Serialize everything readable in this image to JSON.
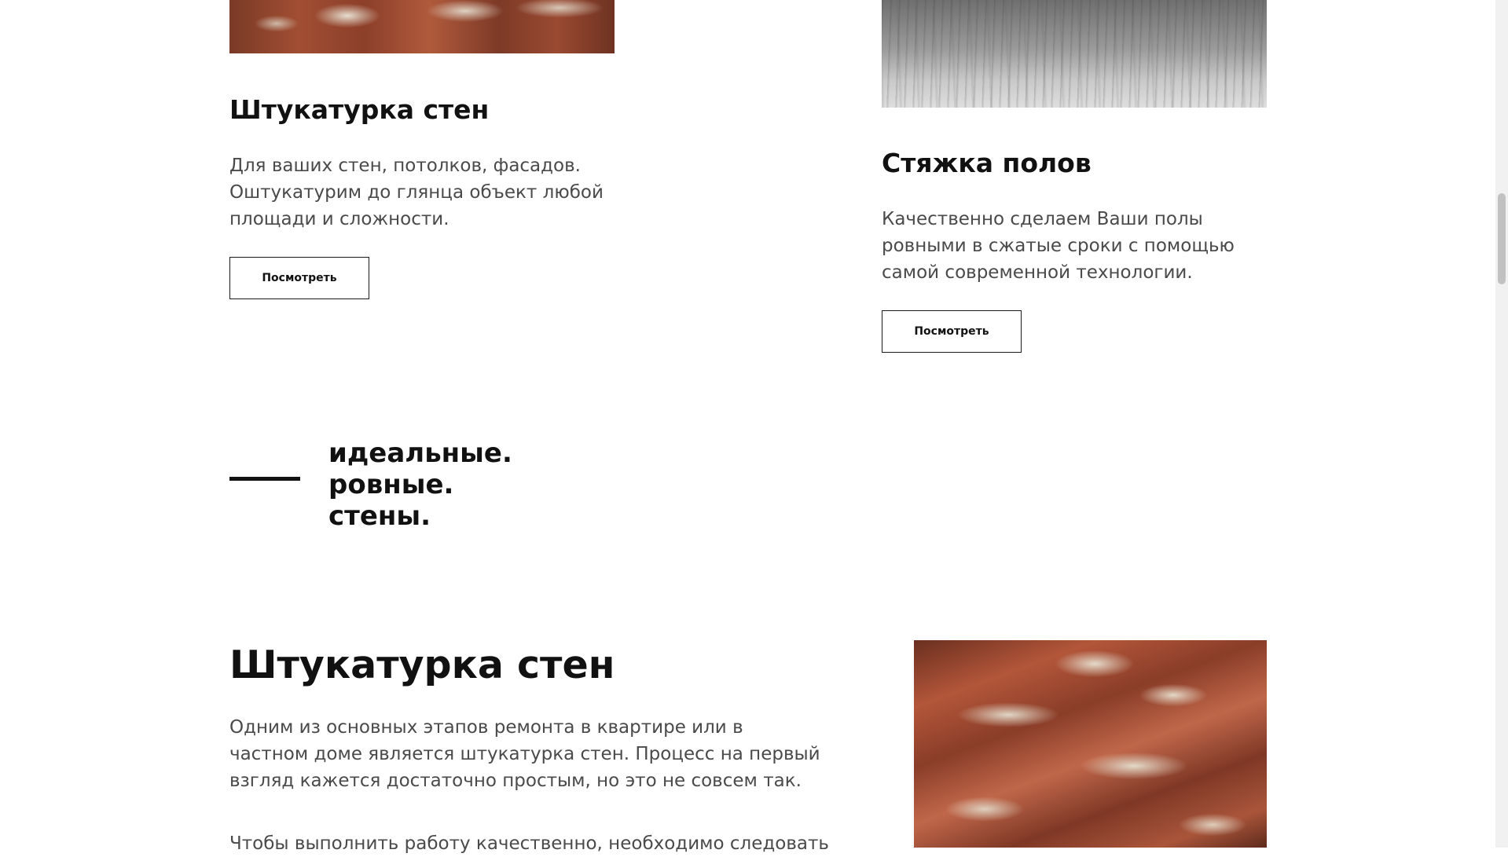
{
  "cards": [
    {
      "title": "Штукатурка стен",
      "description": "Для ваших стен, потолков, фасадов. Оштукатурим до глянца объект любой площади и сложности.",
      "button_label": "Посмотреть",
      "photo": "brick-plaster-photo"
    },
    {
      "title": "Стяжка полов",
      "description": "Качественно сделаем Ваши полы ровными в сжатые сроки с помощью самой современной технологии.",
      "button_label": "Посмотреть",
      "photo": "wood-floor-photo"
    }
  ],
  "slogan": {
    "line1": "идеальные.",
    "line2": "ровные.",
    "line3": "стены."
  },
  "detail": {
    "title": "Штукатурка стен",
    "paragraph1": "Одним из основных этапов ремонта в квартире или в частном доме является штукатурка стен. Процесс на первый взгляд кажется достаточно простым, но это не совсем так.",
    "paragraph2": "Чтобы выполнить работу качественно, необходимо следовать",
    "photo": "brick-plaster-photo"
  },
  "colors": {
    "background": "#ffffff",
    "text": "#111111",
    "muted_text": "#4a4a4a",
    "button_border": "#1a1a1a"
  }
}
